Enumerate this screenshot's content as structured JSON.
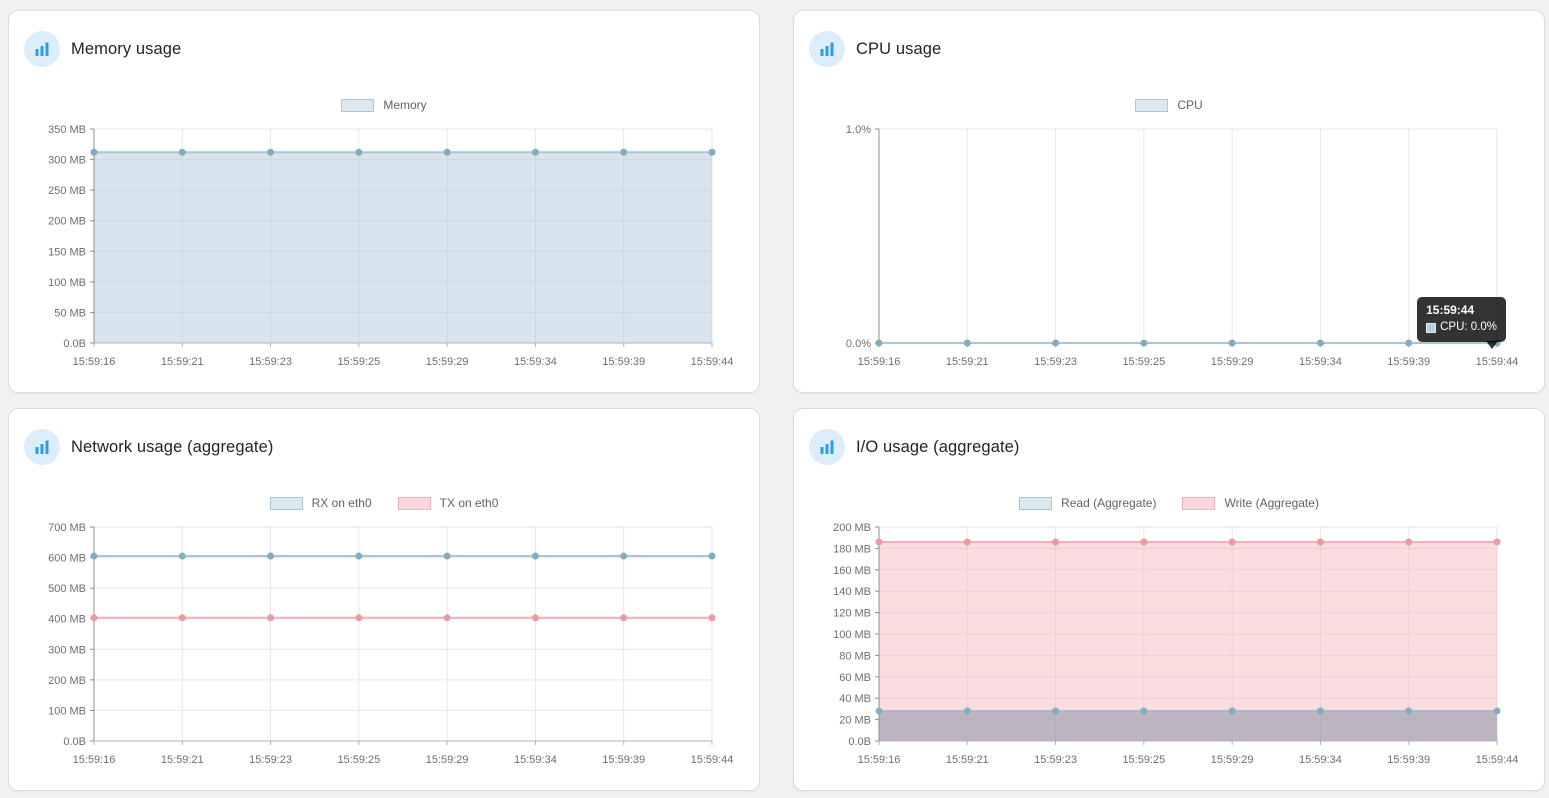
{
  "page": {
    "background": "#f1f1f3"
  },
  "card_style": {
    "background": "#ffffff",
    "border": "#dcdce0"
  },
  "icon": {
    "name": "bar-chart-icon",
    "circle_color": "#dcedfb",
    "bar_color": "#2e9be5"
  },
  "axis_style": {
    "grid": "#e6e6e6",
    "axis_y": "#8f8f8f",
    "axis_x": "#b3b3b3",
    "tick_text": "#6e6e6e",
    "legend_text": "#5f6368"
  },
  "tooltip": {
    "time": "15:59:44",
    "entry": "CPU: 0.0%",
    "background": "rgba(0,0,0,0.8)",
    "text_color": "#ffffff",
    "swatch_fill": "#b7cedd",
    "swatch_border": "#e3edf3"
  },
  "chart_data": [
    {
      "type": "area",
      "title": "Memory usage",
      "categories": [
        "15:59:16",
        "15:59:21",
        "15:59:23",
        "15:59:25",
        "15:59:29",
        "15:59:34",
        "15:59:39",
        "15:59:44"
      ],
      "ylim": [
        0,
        350
      ],
      "grid": true,
      "legend_position": "top-center",
      "yticks": [
        {
          "value": 0,
          "label": "0.0B"
        },
        {
          "value": 50,
          "label": "50 MB"
        },
        {
          "value": 100,
          "label": "100 MB"
        },
        {
          "value": 150,
          "label": "150 MB"
        },
        {
          "value": 200,
          "label": "200 MB"
        },
        {
          "value": 250,
          "label": "250 MB"
        },
        {
          "value": 300,
          "label": "300 MB"
        },
        {
          "value": 350,
          "label": "350 MB"
        }
      ],
      "series": [
        {
          "name": "Memory",
          "unit": "MB",
          "values": [
            312,
            312,
            312,
            312,
            312,
            312,
            312,
            312
          ],
          "line_color": "#a9c6d8",
          "point_color": "#85abc1",
          "fill_color": "rgba(168,198,217,0.45)",
          "swatch_fill": "#dde8ee",
          "swatch_border": "#aac7d8"
        }
      ]
    },
    {
      "type": "line",
      "title": "CPU usage",
      "categories": [
        "15:59:16",
        "15:59:21",
        "15:59:23",
        "15:59:25",
        "15:59:29",
        "15:59:34",
        "15:59:39",
        "15:59:44"
      ],
      "ylim": [
        0,
        1
      ],
      "grid": true,
      "legend_position": "top-center",
      "yticks": [
        {
          "value": 0,
          "label": "0.0%"
        },
        {
          "value": 1,
          "label": "1.0%"
        }
      ],
      "series": [
        {
          "name": "CPU",
          "unit": "%",
          "values": [
            0,
            0,
            0,
            0,
            0,
            0,
            0,
            0
          ],
          "line_color": "#a9c6d8",
          "point_color": "#85abc1",
          "fill_color": null,
          "swatch_fill": "#dde8ee",
          "swatch_border": "#aac7d8"
        }
      ]
    },
    {
      "type": "line",
      "title": "Network usage (aggregate)",
      "categories": [
        "15:59:16",
        "15:59:21",
        "15:59:23",
        "15:59:25",
        "15:59:29",
        "15:59:34",
        "15:59:39",
        "15:59:44"
      ],
      "ylim": [
        0,
        700
      ],
      "grid": true,
      "legend_position": "top-center",
      "yticks": [
        {
          "value": 0,
          "label": "0.0B"
        },
        {
          "value": 100,
          "label": "100 MB"
        },
        {
          "value": 200,
          "label": "200 MB"
        },
        {
          "value": 300,
          "label": "300 MB"
        },
        {
          "value": 400,
          "label": "400 MB"
        },
        {
          "value": 500,
          "label": "500 MB"
        },
        {
          "value": 600,
          "label": "600 MB"
        },
        {
          "value": 700,
          "label": "700 MB"
        }
      ],
      "series": [
        {
          "name": "RX on eth0",
          "unit": "MB",
          "values": [
            605,
            605,
            605,
            605,
            605,
            605,
            605,
            605
          ],
          "line_color": "#a9c6d8",
          "point_color": "#85abc1",
          "fill_color": null,
          "swatch_fill": "#dde8ee",
          "swatch_border": "#aac7d8"
        },
        {
          "name": "TX on eth0",
          "unit": "MB",
          "values": [
            403,
            403,
            403,
            403,
            403,
            403,
            403,
            403
          ],
          "line_color": "#f4b0b6",
          "point_color": "#ee98a0",
          "fill_color": null,
          "swatch_fill": "#fbd8da",
          "swatch_border": "#f3b2b7"
        }
      ]
    },
    {
      "type": "area",
      "title": "I/O usage (aggregate)",
      "categories": [
        "15:59:16",
        "15:59:21",
        "15:59:23",
        "15:59:25",
        "15:59:29",
        "15:59:34",
        "15:59:39",
        "15:59:44"
      ],
      "ylim": [
        0,
        200
      ],
      "grid": true,
      "legend_position": "top-center",
      "yticks": [
        {
          "value": 0,
          "label": "0.0B"
        },
        {
          "value": 20,
          "label": "20 MB"
        },
        {
          "value": 40,
          "label": "40 MB"
        },
        {
          "value": 60,
          "label": "60 MB"
        },
        {
          "value": 80,
          "label": "80 MB"
        },
        {
          "value": 100,
          "label": "100 MB"
        },
        {
          "value": 120,
          "label": "120 MB"
        },
        {
          "value": 140,
          "label": "140 MB"
        },
        {
          "value": 160,
          "label": "160 MB"
        },
        {
          "value": 180,
          "label": "180 MB"
        },
        {
          "value": 200,
          "label": "200 MB"
        }
      ],
      "series": [
        {
          "name": "Read (Aggregate)",
          "unit": "MB",
          "values": [
            28,
            28,
            28,
            28,
            28,
            28,
            28,
            28
          ],
          "line_color": "#a2bccd",
          "point_color": "#85abc1",
          "fill_color": "rgba(128,142,162,0.5)",
          "swatch_fill": "#dde8ee",
          "swatch_border": "#aac7d8"
        },
        {
          "name": "Write (Aggregate)",
          "unit": "MB",
          "values": [
            186,
            186,
            186,
            186,
            186,
            186,
            186,
            186
          ],
          "line_color": "#f4b0b6",
          "point_color": "#ee98a0",
          "fill_color": "rgba(246,180,186,0.45)",
          "swatch_fill": "#fbd8da",
          "swatch_border": "#f3b2b7"
        }
      ]
    }
  ]
}
